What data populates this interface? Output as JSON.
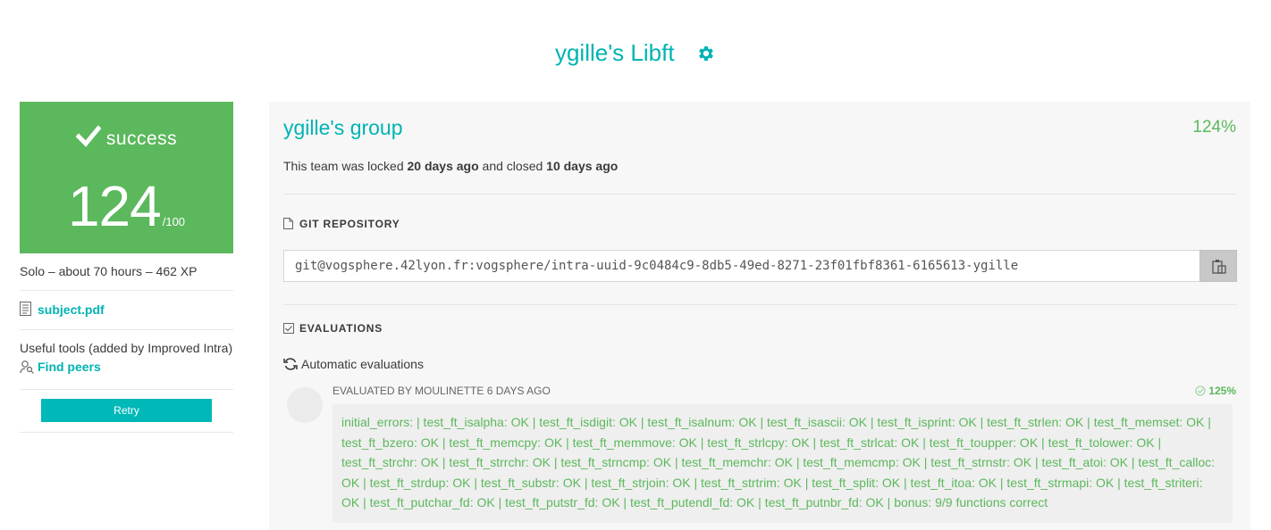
{
  "header": {
    "title": "ygille's Libft",
    "settings_icon": "gear-icon"
  },
  "status_card": {
    "status": "success",
    "score": "124",
    "max": "/100",
    "color": "#5cb85c"
  },
  "sidebar": {
    "meta": "Solo – about 70 hours – 462 XP",
    "subject_link": "subject.pdf",
    "tools_label": "Useful tools (added by Improved Intra)",
    "find_peers": "Find peers",
    "retry_button": "Retry"
  },
  "team": {
    "name": "ygille's group",
    "percent": "124%",
    "locked_prefix": "This team was locked ",
    "locked_when": "20 days ago",
    "closed_prefix": " and closed ",
    "closed_when": "10 days ago"
  },
  "git": {
    "section_label": "GIT REPOSITORY",
    "url": "git@vogsphere.42lyon.fr:vogsphere/intra-uuid-9c0484c9-8db5-49ed-8271-23f01fbf8361-6165613-ygille"
  },
  "evaluations": {
    "section_label": "EVALUATIONS",
    "automatic_label": "Automatic evaluations",
    "evaluated_by": "EVALUATED BY MOULINETTE 6 DAYS AGO",
    "score": "125%",
    "result": "initial_errors:  | test_ft_isalpha: OK | test_ft_isdigit: OK | test_ft_isalnum: OK | test_ft_isascii: OK | test_ft_isprint: OK | test_ft_strlen: OK | test_ft_memset: OK | test_ft_bzero: OK | test_ft_memcpy: OK | test_ft_memmove: OK | test_ft_strlcpy: OK | test_ft_strlcat: OK | test_ft_toupper: OK | test_ft_tolower: OK | test_ft_strchr: OK | test_ft_strrchr: OK | test_ft_strncmp: OK | test_ft_memchr: OK | test_ft_memcmp: OK | test_ft_strnstr: OK | test_ft_atoi: OK | test_ft_calloc: OK | test_ft_strdup: OK | test_ft_substr: OK | test_ft_strjoin: OK | test_ft_strtrim: OK | test_ft_split: OK | test_ft_itoa: OK | test_ft_strmapi: OK | test_ft_striteri: OK | test_ft_putchar_fd: OK | test_ft_putstr_fd: OK | test_ft_putendl_fd: OK | test_ft_putnbr_fd: OK | bonus: 9/9 functions correct"
  },
  "colors": {
    "accent": "#00b3b3",
    "success": "#5cb85c"
  }
}
